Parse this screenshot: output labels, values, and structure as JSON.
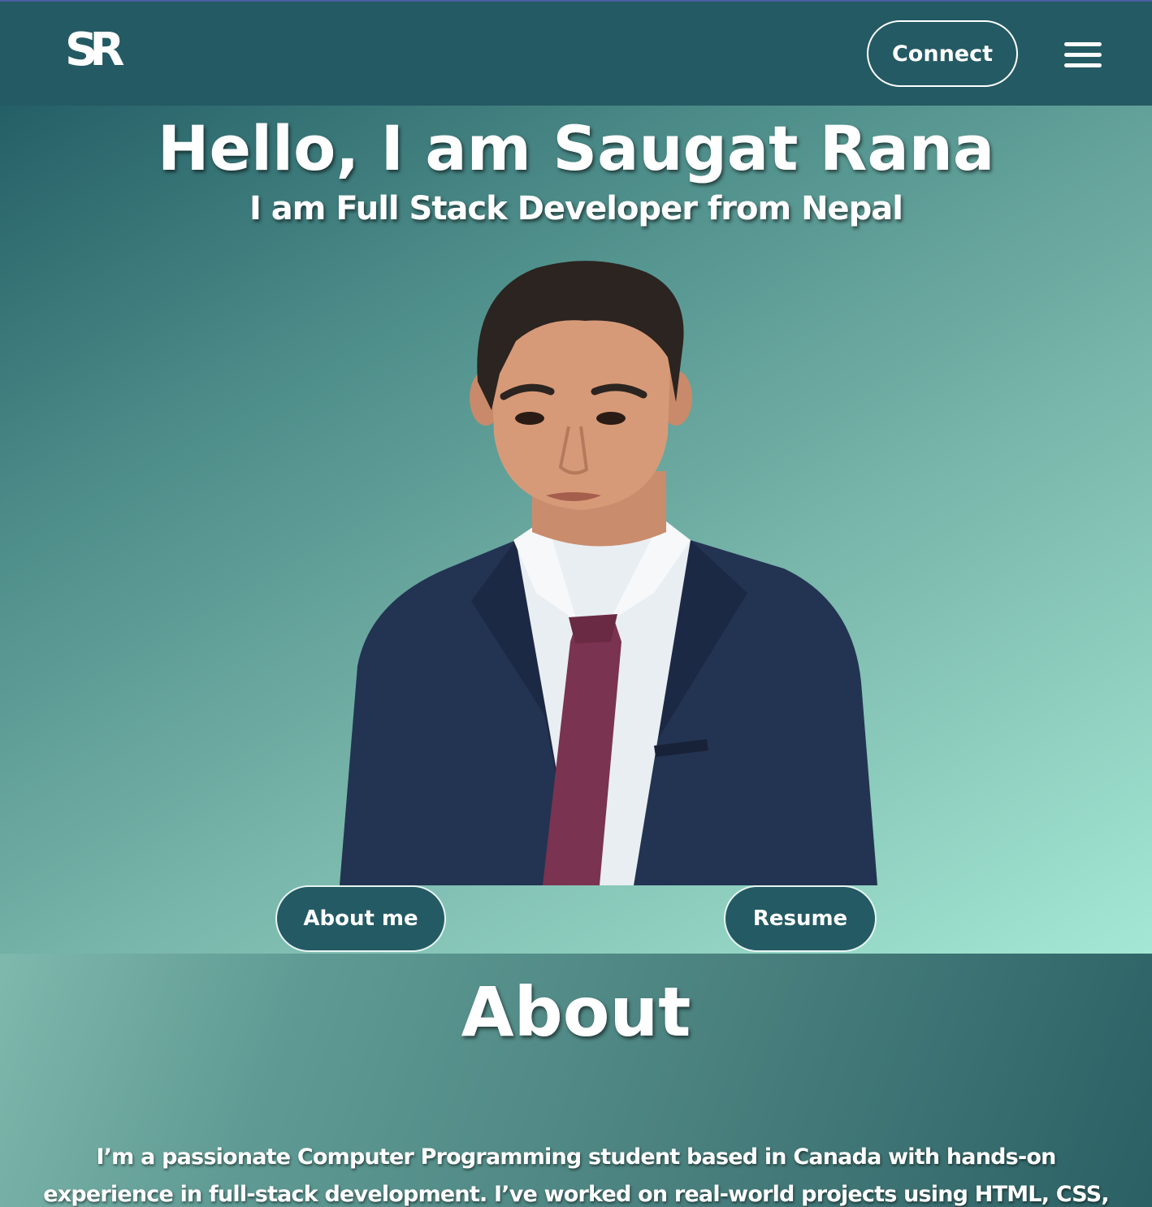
{
  "navbar": {
    "logo_text": "SR",
    "connect_label": "Connect",
    "menu_icon": "hamburger-menu-icon"
  },
  "hero": {
    "title": "Hello, I am Saugat Rana",
    "subtitle": "I am Full Stack Developer from Nepal",
    "about_button_label": "About me",
    "resume_button_label": "Resume"
  },
  "about": {
    "heading": "About",
    "text": "I’m a passionate Computer Programming student based in Canada with hands-on experience in full-stack development. I’ve worked on real-world projects using HTML, CSS, JavaScript, React, and"
  },
  "colors": {
    "nav_background": "#245a63",
    "button_background": "#245a63",
    "hero_gradient_start": "#245f66",
    "hero_gradient_end": "#a4e8d4",
    "text": "#ffffff"
  }
}
